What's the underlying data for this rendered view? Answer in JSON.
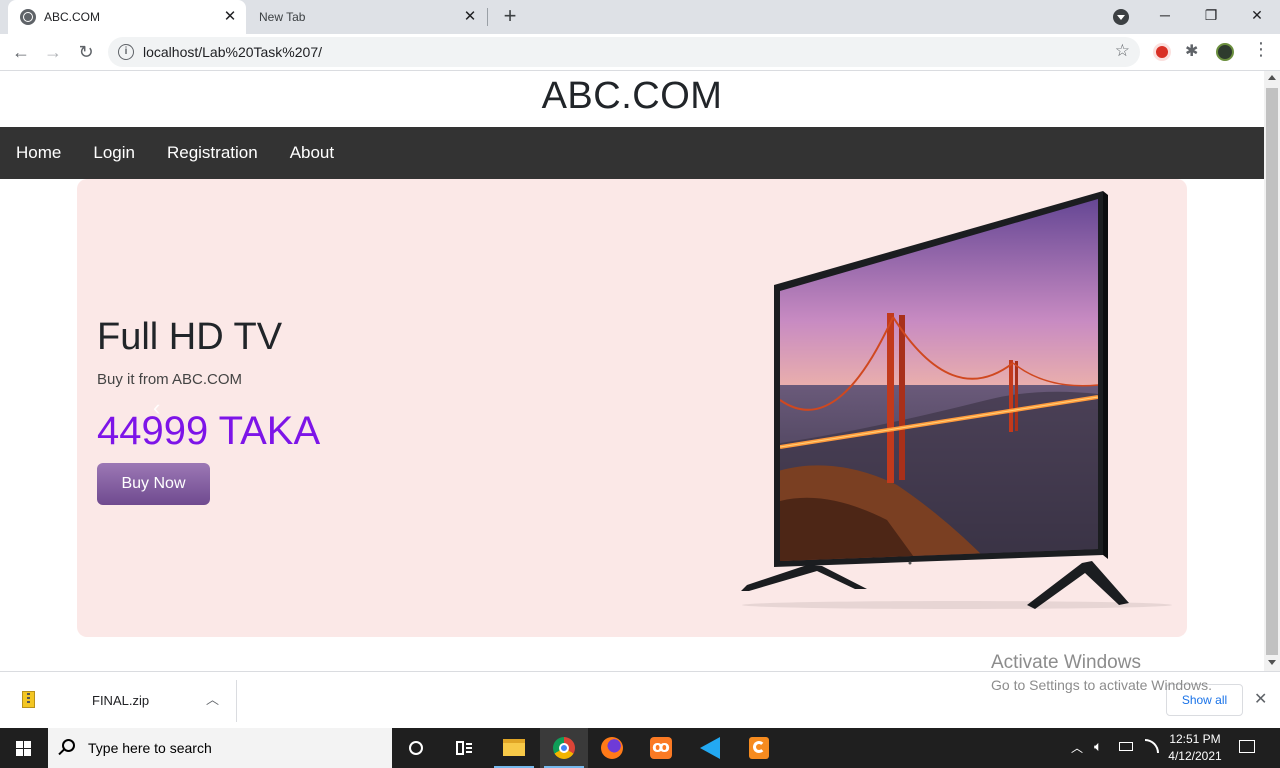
{
  "browser": {
    "tabs": [
      {
        "title": "ABC.COM",
        "active": true
      },
      {
        "title": "New Tab",
        "active": false
      }
    ],
    "new_tab_label": "+",
    "url": "localhost/Lab%20Task%207/"
  },
  "site": {
    "title": "ABC.COM",
    "nav": [
      "Home",
      "Login",
      "Registration",
      "About"
    ]
  },
  "hero": {
    "title": "Full HD TV",
    "subtitle": "Buy it from ABC.COM",
    "price": "44999 TAKA",
    "button_label": "Buy Now",
    "price_color": "#7d14e8",
    "background_color": "#fbe8e7"
  },
  "downloads": {
    "file_name": "FINAL.zip",
    "show_all_label": "Show all"
  },
  "watermark": {
    "line1": "Activate Windows",
    "line2": "Go to Settings to activate Windows."
  },
  "taskbar": {
    "search_placeholder": "Type here to search",
    "time": "12:51 PM",
    "date": "4/12/2021"
  }
}
